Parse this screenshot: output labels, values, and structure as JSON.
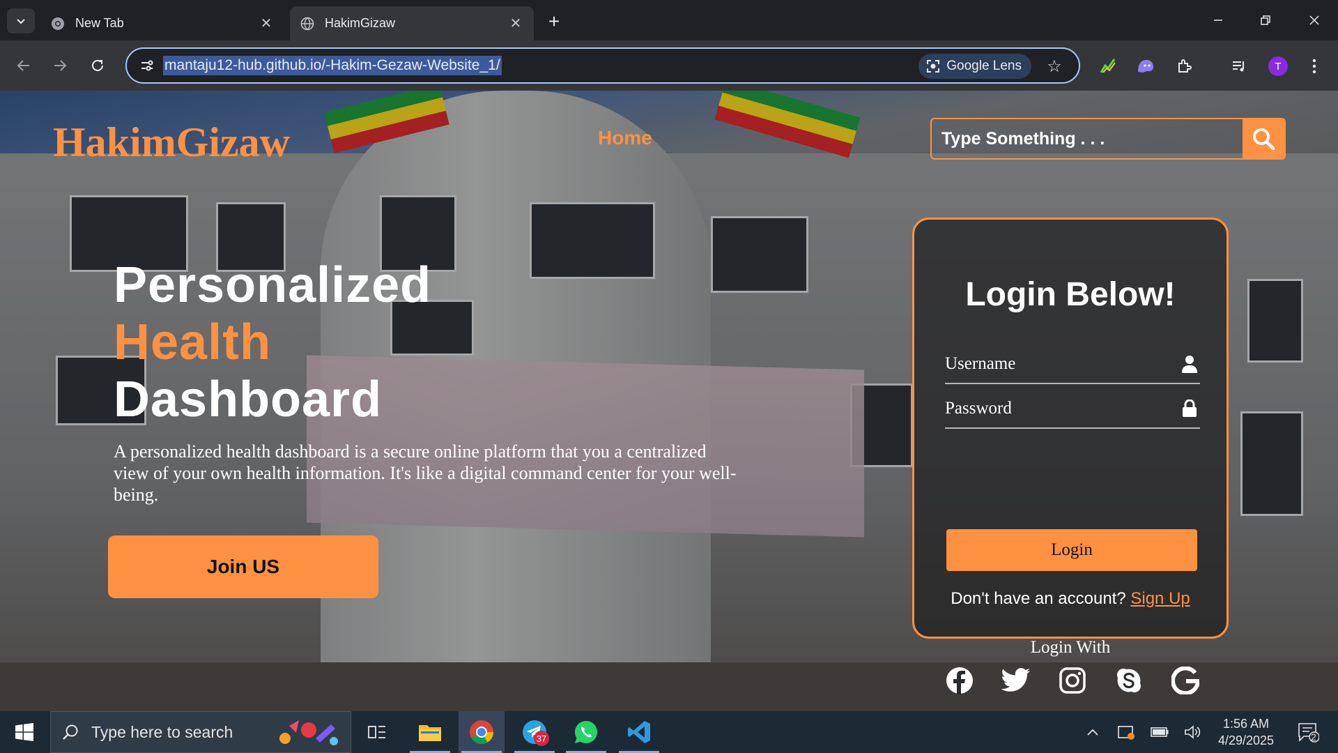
{
  "browser": {
    "tabs": [
      {
        "title": "New Tab",
        "active": false
      },
      {
        "title": "HakimGizaw",
        "active": true
      }
    ],
    "url": "mantaju12-hub.github.io/-Hakim-Gezaw-Website_1/",
    "lens_label": "Google Lens",
    "profile_initial": "T"
  },
  "site": {
    "logo": "HakimGizaw",
    "nav": {
      "home": "Home"
    },
    "search": {
      "placeholder": "Type Something . . ."
    },
    "hero": {
      "line1": "Personalized",
      "line2": "Health",
      "line3": "Dashboard",
      "description": "A personalized health dashboard is a secure online platform that you a centralized view of your own health information. It's like a digital command center for your well-being.",
      "cta": "Join US"
    },
    "login": {
      "title": "Login Below!",
      "username_label": "Username",
      "password_label": "Password",
      "button": "Login",
      "signup_prompt": "Don't have an account?",
      "signup_link": "Sign Up",
      "login_with": "Login With",
      "socials": [
        "facebook-icon",
        "twitter-icon",
        "instagram-icon",
        "skype-icon",
        "google-icon"
      ]
    },
    "colors": {
      "accent": "#ff9142"
    }
  },
  "taskbar": {
    "search_placeholder": "Type here to search",
    "telegram_badge": "37",
    "time": "1:56 AM",
    "date": "4/29/2025",
    "notifications": "2"
  }
}
